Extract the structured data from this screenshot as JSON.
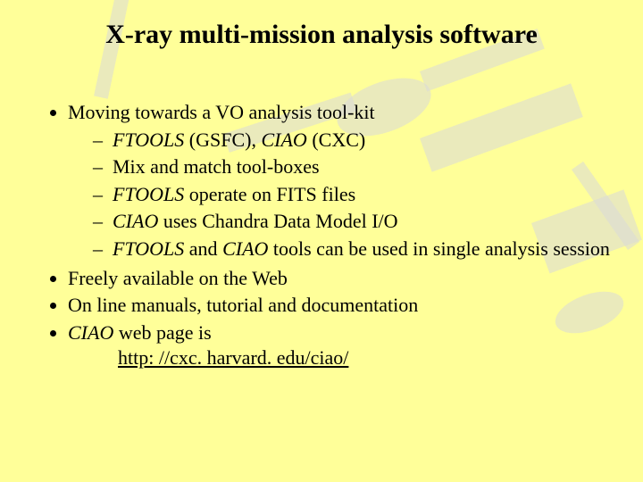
{
  "title": "X-ray multi-mission analysis software",
  "bullets": {
    "b1": {
      "text": "Moving towards a VO analysis tool-kit",
      "sub": {
        "s1_ital1": "FTOOLS",
        "s1_plain1": " (GSFC), ",
        "s1_ital2": "CIAO",
        "s1_plain2": " (CXC)",
        "s2": "Mix and match tool-boxes",
        "s3_ital": "FTOOLS",
        "s3_plain": " operate on FITS files",
        "s4_ital": "CIAO",
        "s4_plain": " uses Chandra Data Model I/O",
        "s5_ital1": "FTOOLS",
        "s5_plain1": " and ",
        "s5_ital2": "CIAO",
        "s5_plain2": " tools can be used in single analysis session"
      }
    },
    "b2": "Freely available on the Web",
    "b3": "On line manuals, tutorial and documentation",
    "b4_ital": "CIAO",
    "b4_plain": " web page is",
    "b4_link": "http: //cxc. harvard. edu/ciao/"
  }
}
